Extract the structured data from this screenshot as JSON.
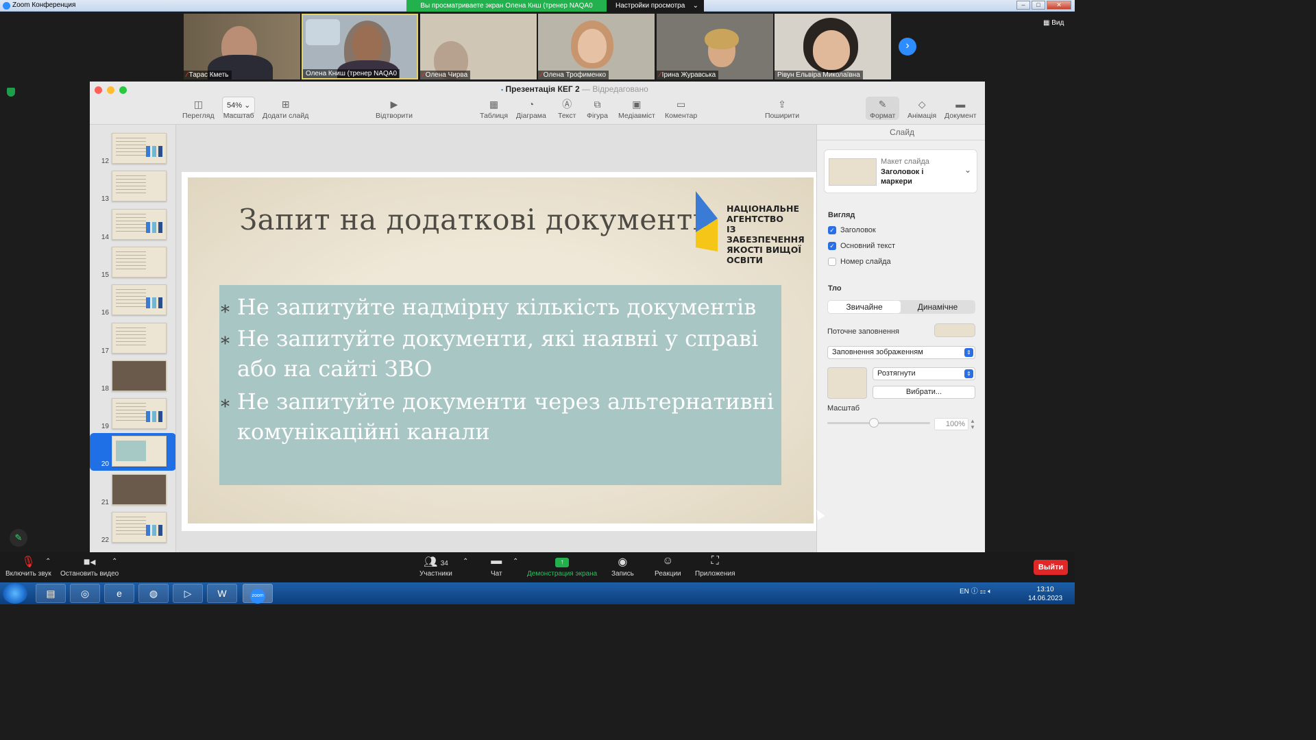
{
  "zoom": {
    "window_title": "Zoom Конференция",
    "share_banner": "Вы просматриваете экран Олена Кнш (тренер NAQA0",
    "view_settings": "Настройки просмотра",
    "view_label": "Вид",
    "participants": [
      {
        "name": "Тарас Кметь",
        "muted": true
      },
      {
        "name": "Олена Книш (тренер NAQA0",
        "muted": false
      },
      {
        "name": "Олена Чирва",
        "muted": true
      },
      {
        "name": "Олена Трофименко",
        "muted": true
      },
      {
        "name": "Ірина Журавська",
        "muted": true
      },
      {
        "name": "Рівун Ельвіра Миколаївна",
        "muted": false
      }
    ],
    "bottom_bar": {
      "unmute": "Включить звук",
      "stop_video": "Остановить видео",
      "participants_label": "Участники",
      "participants_count": "34",
      "chat": "Чат",
      "share": "Демонстрация экрана",
      "record": "Запись",
      "reactions": "Реакции",
      "apps": "Приложения",
      "leave": "Выйти"
    }
  },
  "keynote": {
    "doc_name": "Презентація КЕГ 2",
    "doc_status": "Відредаговано",
    "toolbar": {
      "view": "Перегляд",
      "zoom_value": "54%",
      "zoom": "Масштаб",
      "add_slide": "Додати слайд",
      "play": "Відтворити",
      "table": "Таблиця",
      "chart": "Діаграма",
      "text": "Текст",
      "shape": "Фігура",
      "media": "Медіавміст",
      "comment": "Коментар",
      "share": "Поширити",
      "format": "Формат",
      "animate": "Анімація",
      "document": "Документ"
    },
    "navigator": {
      "slides": [
        {
          "num": "12",
          "kind": "chart"
        },
        {
          "num": "13",
          "kind": "text"
        },
        {
          "num": "14",
          "kind": "chart"
        },
        {
          "num": "15",
          "kind": "text"
        },
        {
          "num": "16",
          "kind": "chart"
        },
        {
          "num": "17",
          "kind": "text"
        },
        {
          "num": "18",
          "kind": "photo"
        },
        {
          "num": "19",
          "kind": "chart"
        },
        {
          "num": "20",
          "kind": "teal",
          "selected": true
        },
        {
          "num": "21",
          "kind": "photo"
        },
        {
          "num": "22",
          "kind": "chart"
        }
      ]
    },
    "slide": {
      "title": "Запит на додаткові документи",
      "logo_lines": [
        "НАЦІОНАЛЬНЕ",
        "АГЕНТСТВО",
        "ІЗ ЗАБЕЗПЕЧЕННЯ",
        "ЯКОСТІ ВИЩОЇ ОСВІТИ"
      ],
      "bullets": [
        "Не запитуйте надмірну кількість документів",
        "Не запитуйте документи, які наявні у справі або на сайті ЗВО",
        "Не запитуйте документи через альтернативні комунікаційні канали"
      ]
    },
    "inspector": {
      "tab": "Слайд",
      "layout_label": "Макет слайда",
      "layout_name": "Заголовок і маркери",
      "appearance": "Вигляд",
      "title_check": "Заголовок",
      "body_check": "Основний текст",
      "slide_number_check": "Номер слайда",
      "background": "Тло",
      "bg_standard": "Звичайне",
      "bg_dynamic": "Динамічне",
      "current_fill": "Поточне заповнення",
      "fill_type": "Заповнення зображенням",
      "stretch": "Розтягнути",
      "choose": "Вибрати...",
      "scale": "Масштаб",
      "scale_value": "100%"
    }
  },
  "taskbar": {
    "lang": "EN",
    "time": "13:10",
    "date": "14.06.2023"
  },
  "colors": {
    "zoom_blue": "#2d8cff",
    "share_green": "#22b14c",
    "leave_red": "#e02828",
    "slide_teal": "#a8c6c4",
    "logo_blue": "#3a7bd5",
    "logo_yellow": "#f5c518"
  }
}
